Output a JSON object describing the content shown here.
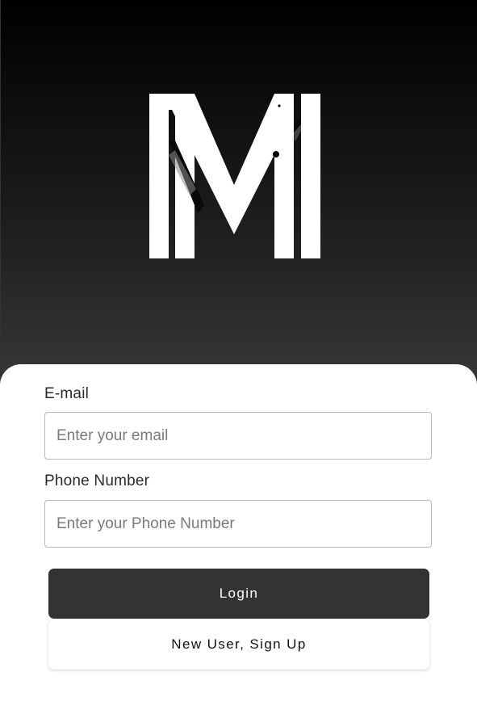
{
  "app": {
    "logo_alt": "M logo"
  },
  "form": {
    "email_label": "E-mail",
    "email_placeholder": "Enter your email",
    "email_value": "",
    "phone_label": "Phone Number",
    "phone_placeholder": "Enter your Phone Number",
    "phone_value": ""
  },
  "actions": {
    "login_label": "Login",
    "signup_label": "New User, Sign Up"
  },
  "colors": {
    "header_top": "#000000",
    "header_bottom": "#383838",
    "primary_button": "#333333",
    "card": "#ffffff"
  }
}
